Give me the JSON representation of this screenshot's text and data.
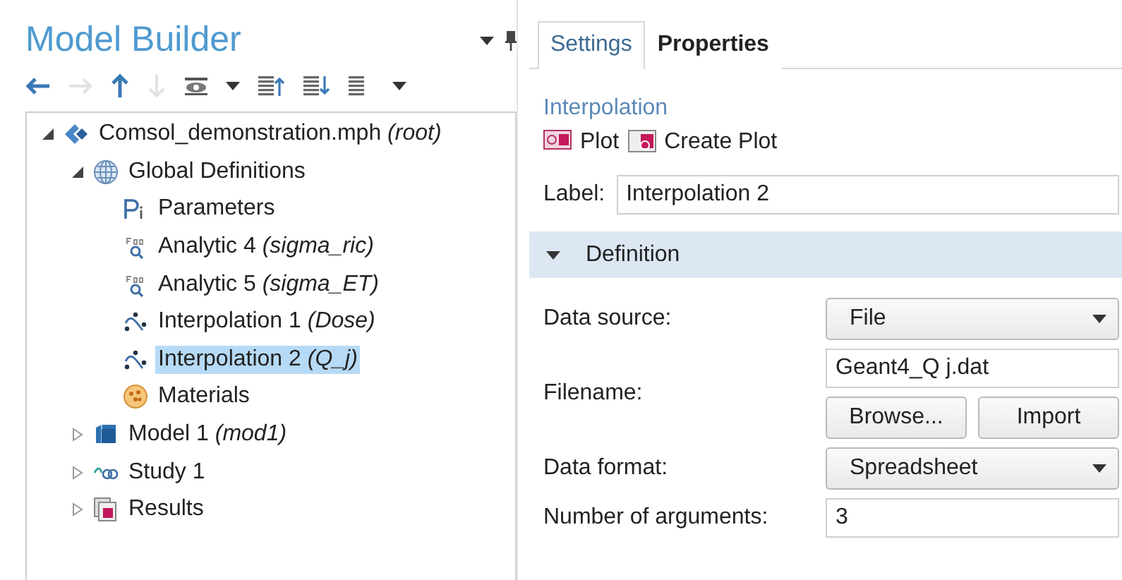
{
  "model_builder": {
    "title": "Model Builder",
    "toolbar": [
      {
        "kind": "back",
        "disabled": false
      },
      {
        "kind": "forward",
        "disabled": true
      },
      {
        "kind": "up",
        "disabled": false
      },
      {
        "kind": "down",
        "disabled": true
      },
      {
        "kind": "eye",
        "disabled": false
      },
      {
        "kind": "caret",
        "disabled": false
      },
      {
        "kind": "sort-up",
        "disabled": false
      },
      {
        "kind": "sort-down",
        "disabled": false
      },
      {
        "kind": "list",
        "disabled": false
      },
      {
        "kind": "caret",
        "disabled": false
      }
    ],
    "tree": [
      {
        "label": "Comsol_demonstration.mph *(root)*",
        "kind": "root",
        "expanded": true,
        "selected": false,
        "children": [
          {
            "label": "Global Definitions",
            "kind": "globe",
            "expanded": true,
            "selected": false,
            "children": [
              {
                "label": "Parameters",
                "kind": "parameters",
                "selected": false
              },
              {
                "label": "Analytic 4 *(sigma_ric)*",
                "kind": "analytic",
                "selected": false
              },
              {
                "label": "Analytic 5 *(sigma_ET)*",
                "kind": "analytic",
                "selected": false
              },
              {
                "label": "Interpolation 1 *(Dose)*",
                "kind": "interpolation",
                "selected": false
              },
              {
                "label": "Interpolation 2 *(Q_j)*",
                "kind": "interpolation",
                "selected": true
              },
              {
                "label": "Materials",
                "kind": "materials",
                "selected": false
              }
            ]
          },
          {
            "label": "Model 1 *(mod1)*",
            "kind": "model",
            "expanded": false,
            "selected": false
          },
          {
            "label": "Study 1",
            "kind": "study",
            "expanded": false,
            "selected": false
          },
          {
            "label": "Results",
            "kind": "results",
            "expanded": false,
            "selected": false
          }
        ]
      }
    ]
  },
  "settings": {
    "tabs": [
      {
        "label": "Settings",
        "selected": true
      },
      {
        "label": "Properties",
        "selected": false
      }
    ],
    "heading": "Interpolation",
    "actions": [
      {
        "label": "Plot",
        "kind": "plot"
      },
      {
        "label": "Create Plot",
        "kind": "create-plot"
      }
    ],
    "label_field": {
      "label": "Label:",
      "value": "Interpolation 2"
    },
    "section": {
      "title": "Definition",
      "expanded": true
    },
    "rows": [
      {
        "kind": "select",
        "label": "Data source:",
        "value": "File"
      },
      {
        "kind": "file",
        "label": "Filename:",
        "value": "Geant4_Q j.dat",
        "buttons": [
          "Browse...",
          "Import"
        ]
      },
      {
        "kind": "select",
        "label": "Data format:",
        "value": "Spreadsheet"
      },
      {
        "kind": "text",
        "label": "Number of arguments:",
        "value": "3"
      }
    ]
  }
}
